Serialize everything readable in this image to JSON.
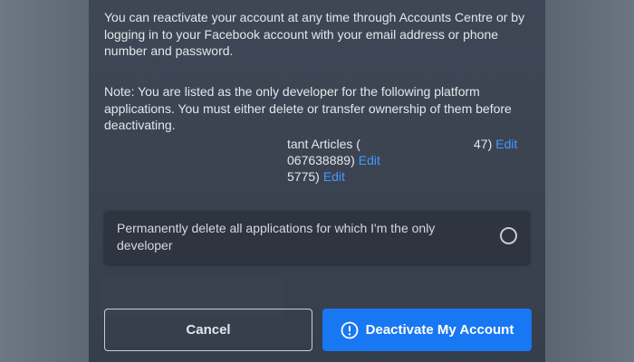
{
  "dialog": {
    "paragraph_reactivate": "You can reactivate your account at any time through Accounts Centre or by logging in to your Facebook account with your email address or phone number and password.",
    "paragraph_note": "Note: You are listed as the only developer for the following platform applications. You must either delete or transfer ownership of them before deactivating.",
    "apps": [
      {
        "text_left": "tant Articles (",
        "text_right": "47)",
        "edit_label": "Edit"
      },
      {
        "text": "067638889)",
        "edit_label": "Edit"
      },
      {
        "text": "5775)",
        "edit_label": "Edit"
      }
    ],
    "delete_option_label": "Permanently delete all applications for which I'm the only developer",
    "cancel_label": "Cancel",
    "deactivate_label": "Deactivate My Account",
    "colors": {
      "primary": "#1877f2",
      "link": "#4599ff",
      "dialog_bg": "#3c4452"
    },
    "icons": {
      "deactivate": "exclamation-circle-icon",
      "radio": "radio-unchecked-icon"
    }
  }
}
